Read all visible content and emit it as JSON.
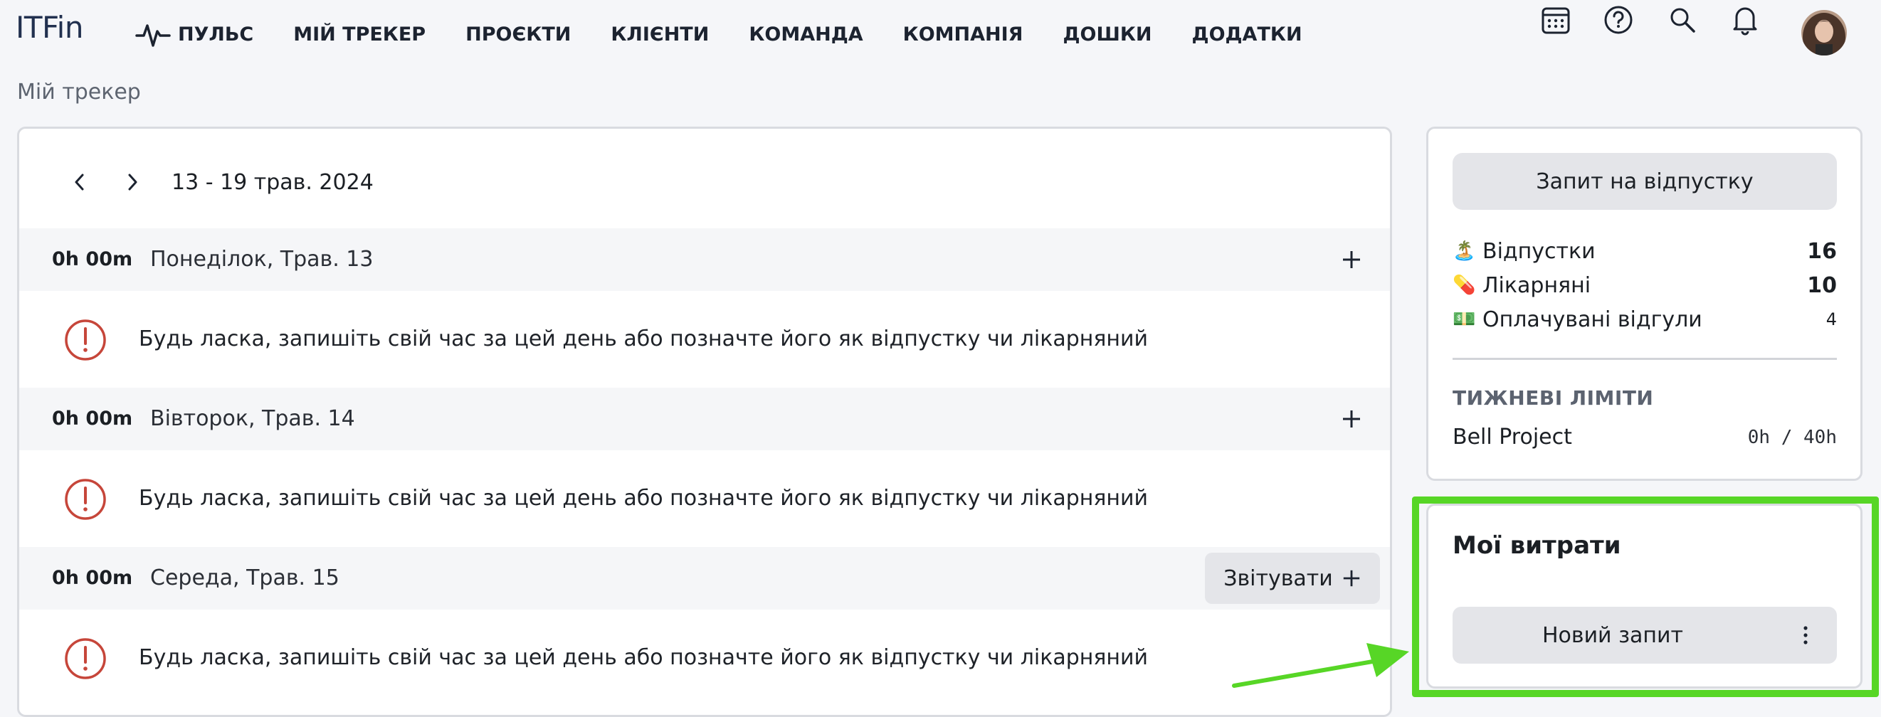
{
  "header": {
    "logo": "ITFin",
    "nav": [
      {
        "label": "ПУЛЬС",
        "icon": "pulse-icon"
      },
      {
        "label": "МІЙ ТРЕКЕР"
      },
      {
        "label": "ПРОЄКТИ"
      },
      {
        "label": "КЛІЄНТИ"
      },
      {
        "label": "КОМАНДА"
      },
      {
        "label": "КОМПАНІЯ"
      },
      {
        "label": "ДОШКИ"
      },
      {
        "label": "ДОДАТКИ"
      }
    ],
    "icons": [
      "calendar-icon",
      "help-icon",
      "search-icon",
      "bell-icon",
      "avatar"
    ]
  },
  "breadcrumb": "Мій трекер",
  "tracker": {
    "week_label": "13 - 19 трав. 2024",
    "days": [
      {
        "hours": "0h 00m",
        "label": "Понеділок, Трав. 13",
        "warning": "Будь ласка, запишіть свій час за цей день або позначте його як відпустку чи лікарняний"
      },
      {
        "hours": "0h 00m",
        "label": "Вівторок, Трав. 14",
        "warning": "Будь ласка, запишіть свій час за цей день або позначте його як відпустку чи лікарняний"
      },
      {
        "hours": "0h 00m",
        "label": "Середа, Трав. 15",
        "report_label": "Звітувати",
        "warning": "Будь ласка, запишіть свій час за цей день або позначте його як відпустку чи лікарняний"
      }
    ]
  },
  "sidebar": {
    "vacation_request": "Запит на відпустку",
    "balances": [
      {
        "emoji": "🏝️",
        "label": "Відпустки",
        "value": "16"
      },
      {
        "emoji": "💊",
        "label": "Лікарняні",
        "value": "10"
      },
      {
        "emoji": "💵",
        "label": "Оплачувані відгули",
        "value": "4"
      }
    ],
    "limits_title": "ТИЖНЕВІ ЛІМІТИ",
    "limits": [
      {
        "project": "Bell Project",
        "value": "0h / 40h"
      }
    ]
  },
  "expenses": {
    "title": "Мої витрати",
    "new_request": "Новий запит"
  },
  "colors": {
    "highlight": "#57d626",
    "warning": "#c6463a",
    "logo": "#21304f"
  }
}
